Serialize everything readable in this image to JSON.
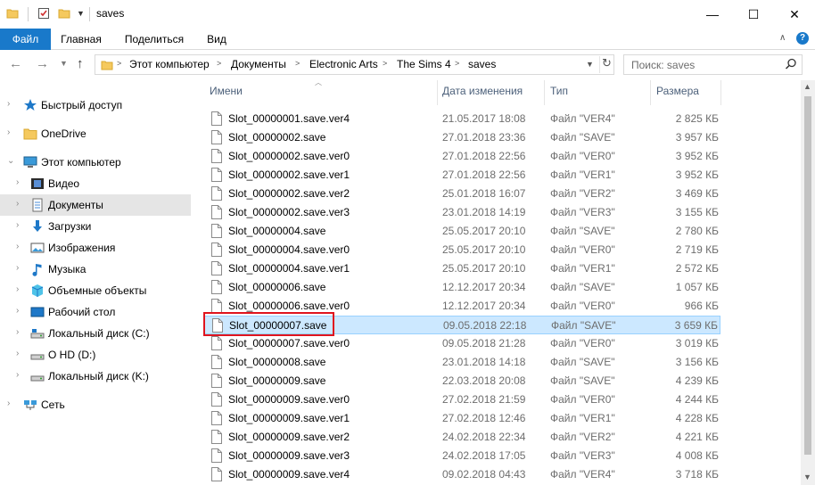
{
  "window": {
    "title": "saves",
    "minimize_glyph": "—",
    "maximize_glyph": "☐",
    "close_glyph": "✕"
  },
  "ribbon": {
    "tabs": [
      "Файл",
      "Главная",
      "Поделиться",
      "Вид"
    ],
    "collapse_glyph": "∧",
    "help_glyph": "?"
  },
  "address": {
    "crumbs": [
      "Этот компьютер",
      "Документы",
      "Electronic Arts",
      "The Sims 4",
      "saves"
    ],
    "search_placeholder": "Поиск: saves"
  },
  "nav": {
    "items": [
      {
        "label": "Быстрый доступ",
        "icon": "star-icon",
        "expand": "›"
      },
      {
        "label": "OneDrive",
        "icon": "folder-icon",
        "expand": "›"
      },
      {
        "label": "Этот компьютер",
        "icon": "computer-icon",
        "expand": "⌄"
      },
      {
        "label": "Видео",
        "icon": "video-icon",
        "expand": "›"
      },
      {
        "label": "Документы",
        "icon": "document-icon",
        "expand": "›"
      },
      {
        "label": "Загрузки",
        "icon": "download-icon",
        "expand": "›"
      },
      {
        "label": "Изображения",
        "icon": "image-icon",
        "expand": "›"
      },
      {
        "label": "Музыка",
        "icon": "music-icon",
        "expand": "›"
      },
      {
        "label": "Объемные объекты",
        "icon": "cube-icon",
        "expand": "›"
      },
      {
        "label": "Рабочий стол",
        "icon": "desktop-icon",
        "expand": "›"
      },
      {
        "label": "Локальный диск (C:)",
        "icon": "drive-icon",
        "expand": "›"
      },
      {
        "label": "O HD (D:)",
        "icon": "drive-icon",
        "expand": "›"
      },
      {
        "label": "Локальный диск (K:)",
        "icon": "drive-icon",
        "expand": "›"
      },
      {
        "label": "Сеть",
        "icon": "network-icon",
        "expand": "›"
      }
    ],
    "selected_index": 4
  },
  "columns": {
    "name": "Имени",
    "date": "Дата изменения",
    "type": "Тип",
    "size": "Размера"
  },
  "files": [
    {
      "name": "Slot_00000001.save.ver4",
      "date": "21.05.2017 18:08",
      "type": "Файл \"VER4\"",
      "size": "2 825 КБ"
    },
    {
      "name": "Slot_00000002.save",
      "date": "27.01.2018 23:36",
      "type": "Файл \"SAVE\"",
      "size": "3 957 КБ"
    },
    {
      "name": "Slot_00000002.save.ver0",
      "date": "27.01.2018 22:56",
      "type": "Файл \"VER0\"",
      "size": "3 952 КБ"
    },
    {
      "name": "Slot_00000002.save.ver1",
      "date": "27.01.2018 22:56",
      "type": "Файл \"VER1\"",
      "size": "3 952 КБ"
    },
    {
      "name": "Slot_00000002.save.ver2",
      "date": "25.01.2018 16:07",
      "type": "Файл \"VER2\"",
      "size": "3 469 КБ"
    },
    {
      "name": "Slot_00000002.save.ver3",
      "date": "23.01.2018 14:19",
      "type": "Файл \"VER3\"",
      "size": "3 155 КБ"
    },
    {
      "name": "Slot_00000004.save",
      "date": "25.05.2017 20:10",
      "type": "Файл \"SAVE\"",
      "size": "2 780 КБ"
    },
    {
      "name": "Slot_00000004.save.ver0",
      "date": "25.05.2017 20:10",
      "type": "Файл \"VER0\"",
      "size": "2 719 КБ"
    },
    {
      "name": "Slot_00000004.save.ver1",
      "date": "25.05.2017 20:10",
      "type": "Файл \"VER1\"",
      "size": "2 572 КБ"
    },
    {
      "name": "Slot_00000006.save",
      "date": "12.12.2017 20:34",
      "type": "Файл \"SAVE\"",
      "size": "1 057 КБ"
    },
    {
      "name": "Slot_00000006.save.ver0",
      "date": "12.12.2017 20:34",
      "type": "Файл \"VER0\"",
      "size": "966 КБ"
    },
    {
      "name": "Slot_00000007.save",
      "date": "09.05.2018 22:18",
      "type": "Файл \"SAVE\"",
      "size": "3 659 КБ"
    },
    {
      "name": "Slot_00000007.save.ver0",
      "date": "09.05.2018 21:28",
      "type": "Файл \"VER0\"",
      "size": "3 019 КБ"
    },
    {
      "name": "Slot_00000008.save",
      "date": "23.01.2018 14:18",
      "type": "Файл \"SAVE\"",
      "size": "3 156 КБ"
    },
    {
      "name": "Slot_00000009.save",
      "date": "22.03.2018 20:08",
      "type": "Файл \"SAVE\"",
      "size": "4 239 КБ"
    },
    {
      "name": "Slot_00000009.save.ver0",
      "date": "27.02.2018 21:59",
      "type": "Файл \"VER0\"",
      "size": "4 244 КБ"
    },
    {
      "name": "Slot_00000009.save.ver1",
      "date": "27.02.2018 12:46",
      "type": "Файл \"VER1\"",
      "size": "4 228 КБ"
    },
    {
      "name": "Slot_00000009.save.ver2",
      "date": "24.02.2018 22:34",
      "type": "Файл \"VER2\"",
      "size": "4 221 КБ"
    },
    {
      "name": "Slot_00000009.save.ver3",
      "date": "24.02.2018 17:05",
      "type": "Файл \"VER3\"",
      "size": "4 008 КБ"
    },
    {
      "name": "Slot_00000009.save.ver4",
      "date": "09.02.2018 04:43",
      "type": "Файл \"VER4\"",
      "size": "3 718 КБ"
    }
  ],
  "selected_file_index": 11,
  "colors": {
    "accent": "#1979ca",
    "selection": "#cce8ff",
    "highlight_border": "#e0141e"
  }
}
